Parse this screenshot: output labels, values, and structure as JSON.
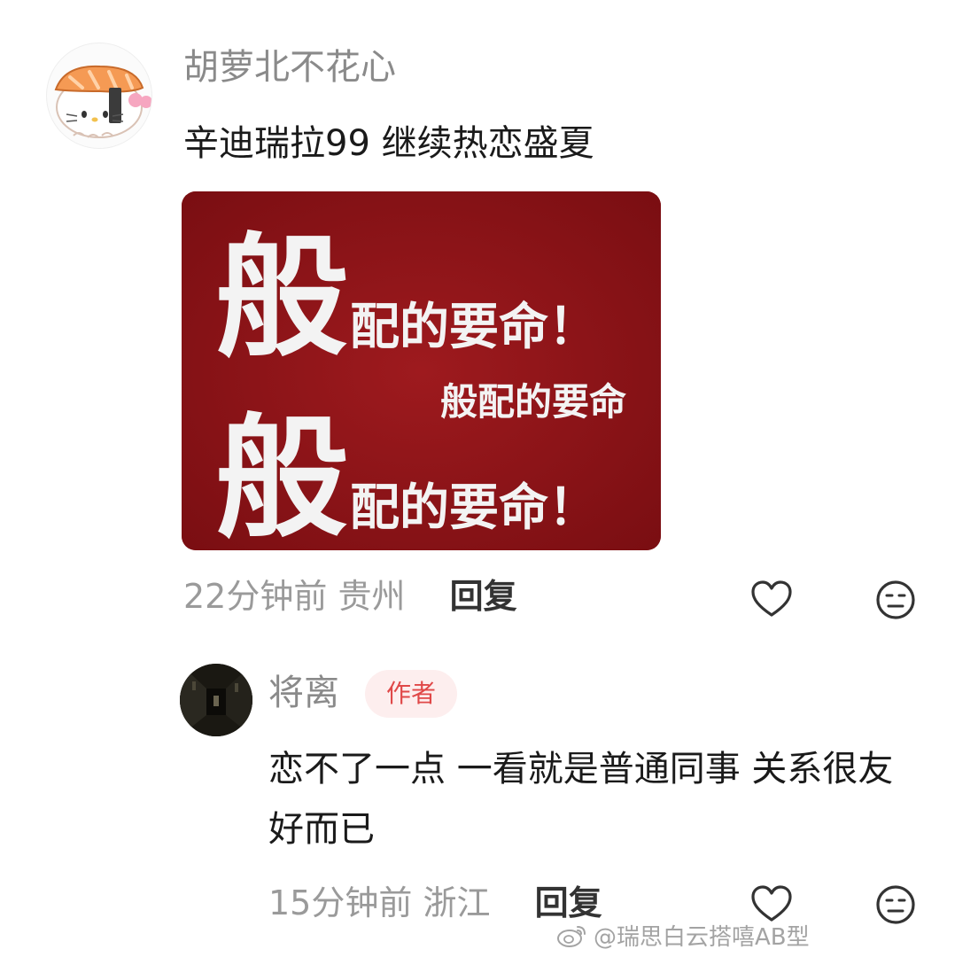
{
  "comments": [
    {
      "username": "胡萝北不花心",
      "text": "辛迪瑞拉99 继续热恋盛夏",
      "image": {
        "big_char": "般",
        "line_rest": "配的要命！",
        "small_line": "般配的要命",
        "background_color": "#8b1317"
      },
      "time": "22分钟前",
      "location": "贵州",
      "reply_label": "回复",
      "like_icon": "heart-outline-icon",
      "dislike_icon": "meh-face-icon"
    },
    {
      "username": "将离",
      "badge": "作者",
      "text": "恋不了一点 一看就是普通同事 关系很友好而已",
      "time": "15分钟前",
      "location": "浙江",
      "reply_label": "回复",
      "like_icon": "heart-outline-icon",
      "dislike_icon": "meh-face-icon"
    }
  ],
  "watermark": {
    "icon": "weibo-logo-icon",
    "text": "@瑞思白云搭嘻AB型"
  },
  "colors": {
    "badge_text": "#e04848",
    "badge_bg": "#fdeeee",
    "image_bg": "#8b1317",
    "meta_text": "#9a9a9a"
  }
}
